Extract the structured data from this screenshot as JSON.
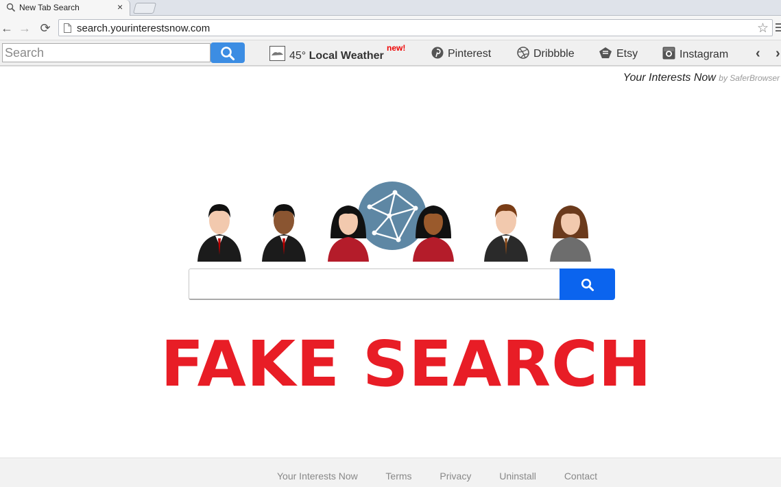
{
  "tab": {
    "title": "New Tab Search",
    "close": "×"
  },
  "address_bar": {
    "url": "search.yourinterestsnow.com",
    "star": "☆"
  },
  "nav": {
    "back": "←",
    "forward": "→",
    "reload": "⟳"
  },
  "ext_toolbar": {
    "search_placeholder": "Search",
    "weather": {
      "temp": "45°",
      "label": "Local Weather",
      "badge": "new!"
    },
    "links": [
      {
        "label": "Pinterest",
        "icon": "pinterest-icon"
      },
      {
        "label": "Dribbble",
        "icon": "dribbble-icon"
      },
      {
        "label": "Etsy",
        "icon": "etsy-icon"
      },
      {
        "label": "Instagram",
        "icon": "instagram-icon"
      }
    ],
    "prev": "‹",
    "next": "›"
  },
  "brand": {
    "name": "Your Interests Now",
    "by": "by SaferBrowser"
  },
  "main_search": {
    "value": ""
  },
  "watermark": "FAKE SEARCH",
  "footer": {
    "links": [
      "Your Interests Now",
      "Terms",
      "Privacy",
      "Uninstall",
      "Contact"
    ]
  },
  "colors": {
    "search_button": "#0b64ee",
    "ext_search_button": "#3c8de3",
    "watermark": "#e81d26",
    "globe": "#5e87a4"
  },
  "icons": [
    "search-icon",
    "page-icon",
    "star-icon",
    "weather-icon",
    "pinterest-icon",
    "dribbble-icon",
    "etsy-icon",
    "instagram-icon",
    "globe-icon"
  ]
}
